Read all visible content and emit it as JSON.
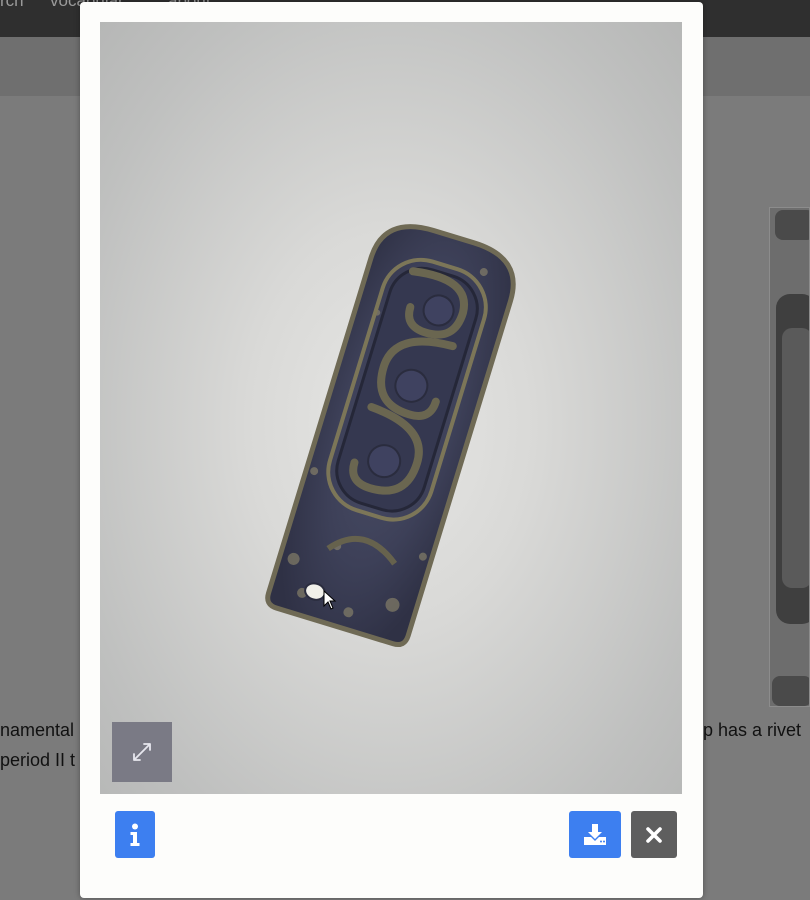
{
  "background": {
    "nav_fragments": [
      "rch",
      "vocabular",
      "about"
    ],
    "text_left_line1": "namental",
    "text_left_line2": "period II t",
    "text_right_line1": "p has a rivet"
  },
  "viewer": {
    "subject": "carved dark stone plaque with spiral ornament and rivet hole",
    "fullscreen_icon": "expand-arrows-icon"
  },
  "buttons": {
    "info_icon": "info-icon",
    "download_icon": "download-icon",
    "close_icon": "close-icon"
  },
  "colors": {
    "primary": "#3d7ff0",
    "close": "#5e5e5e",
    "overlay": "#7b7b7b"
  }
}
